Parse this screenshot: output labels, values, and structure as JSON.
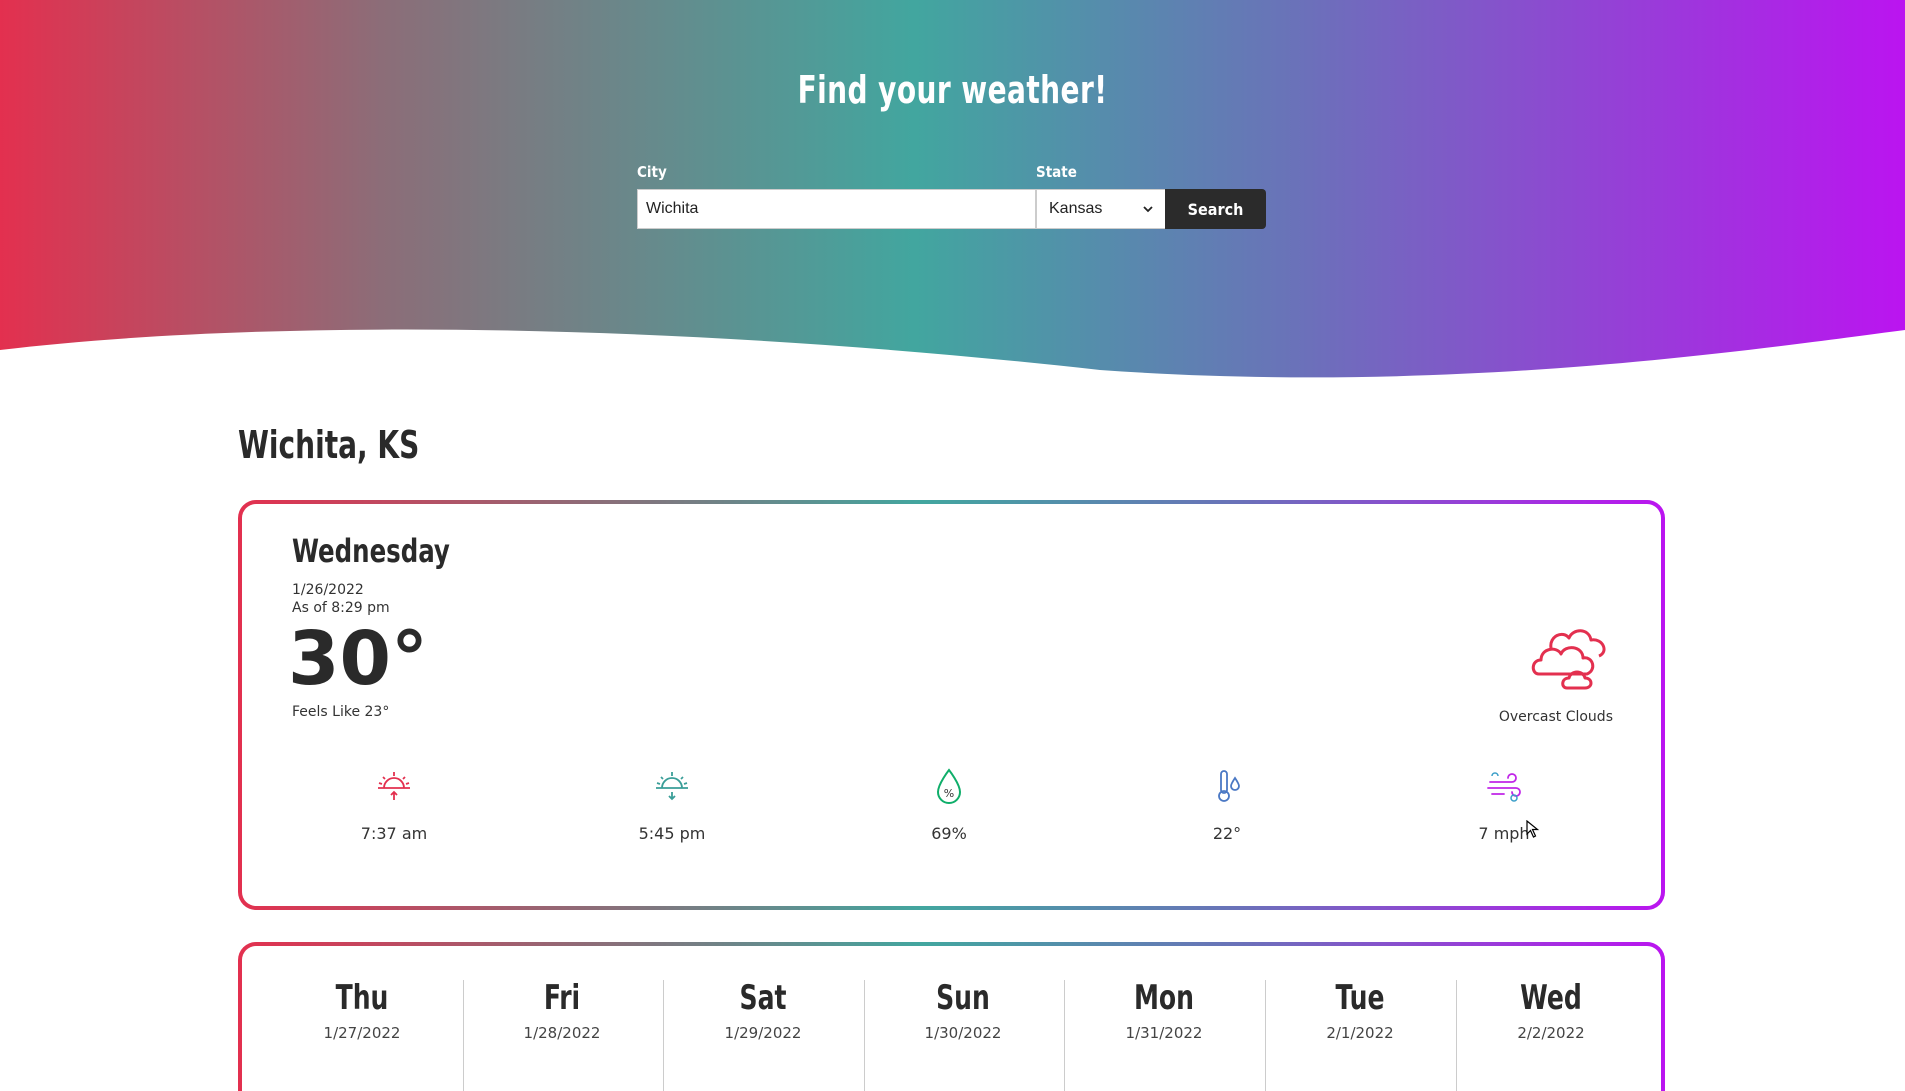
{
  "header": {
    "title": "Find your weather!",
    "city_label": "City",
    "state_label": "State",
    "city_value": "Wichita",
    "state_value": "Kansas",
    "search_label": "Search"
  },
  "location": {
    "title": "Wichita, KS"
  },
  "current": {
    "day": "Wednesday",
    "date": "1/26/2022",
    "as_of": "As of 8:29 pm",
    "temperature": "30°",
    "feels_like": "Feels Like 23°",
    "condition": "Overcast Clouds",
    "condition_icon": "overcast-clouds-icon",
    "stats": [
      {
        "icon": "sunrise-icon",
        "value": "7:37 am"
      },
      {
        "icon": "sunset-icon",
        "value": "5:45 pm"
      },
      {
        "icon": "humidity-icon",
        "value": "69%"
      },
      {
        "icon": "dew-point-icon",
        "value": "22°"
      },
      {
        "icon": "wind-icon",
        "value": "7 mph"
      }
    ]
  },
  "forecast": [
    {
      "day": "Thu",
      "date": "1/27/2022"
    },
    {
      "day": "Fri",
      "date": "1/28/2022"
    },
    {
      "day": "Sat",
      "date": "1/29/2022"
    },
    {
      "day": "Sun",
      "date": "1/30/2022"
    },
    {
      "day": "Mon",
      "date": "1/31/2022"
    },
    {
      "day": "Tue",
      "date": "2/1/2022"
    },
    {
      "day": "Wed",
      "date": "2/2/2022"
    }
  ],
  "colors": {
    "gradient_start": "#e3304f",
    "gradient_mid": "#42a69f",
    "gradient_end": "#bb14f0",
    "button_bg": "#2b2b2b"
  }
}
